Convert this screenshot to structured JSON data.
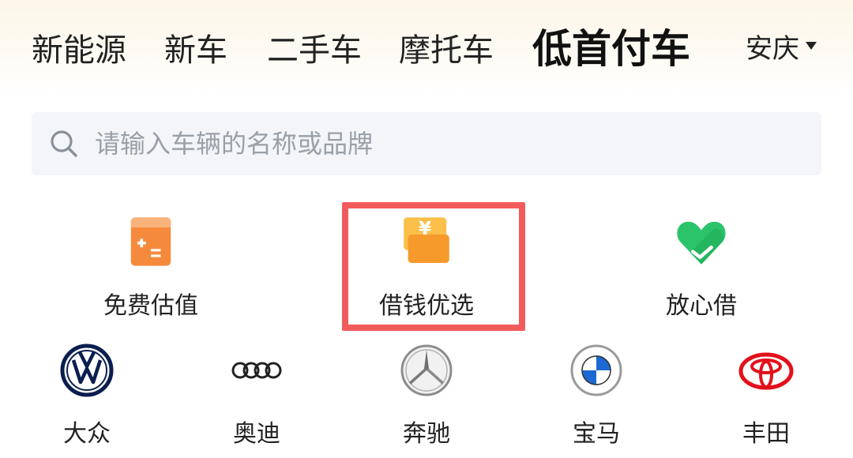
{
  "tabs": [
    {
      "label": "新能源",
      "active": false
    },
    {
      "label": "新车",
      "active": false
    },
    {
      "label": "二手车",
      "active": false
    },
    {
      "label": "摩托车",
      "active": false
    },
    {
      "label": "低首付车",
      "active": true
    }
  ],
  "city": {
    "label": "安庆",
    "icon": "caret-down-icon"
  },
  "search": {
    "placeholder": "请输入车辆的名称或品牌",
    "value": "",
    "icon": "search-icon"
  },
  "features": [
    {
      "label": "免费估值",
      "icon": "calculator-icon"
    },
    {
      "label": "借钱优选",
      "icon": "yuan-wallet-icon",
      "highlighted": true
    },
    {
      "label": "放心借",
      "icon": "heart-check-icon"
    }
  ],
  "brands": [
    {
      "label": "大众",
      "icon": "volkswagen-logo"
    },
    {
      "label": "奥迪",
      "icon": "audi-logo"
    },
    {
      "label": "奔驰",
      "icon": "mercedes-benz-logo"
    },
    {
      "label": "宝马",
      "icon": "bmw-logo"
    },
    {
      "label": "丰田",
      "icon": "toyota-logo"
    }
  ],
  "colors": {
    "accent_underline": "#ffd34d",
    "highlight_border": "#f25b5b",
    "search_bg": "#f3f5f8",
    "placeholder": "#9aa0a8"
  }
}
